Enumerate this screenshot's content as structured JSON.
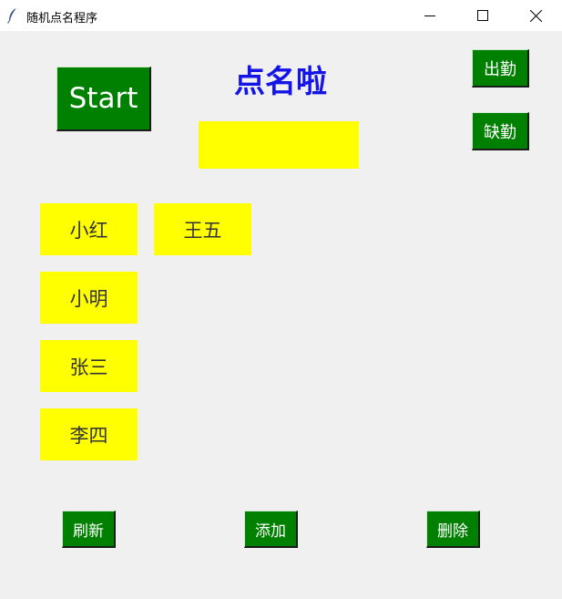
{
  "window": {
    "title": "随机点名程序",
    "controls": [
      "minimize-icon",
      "maximize-icon",
      "close-icon"
    ]
  },
  "main": {
    "heading": "点名啦",
    "start_label": "Start",
    "result": "",
    "present_label": "出勤",
    "absent_label": "缺勤"
  },
  "names": [
    "小红",
    "王五",
    "小明",
    "张三",
    "李四"
  ],
  "actions": {
    "refresh_label": "刷新",
    "add_label": "添加",
    "delete_label": "删除"
  },
  "colors": {
    "button_bg": "#008000",
    "button_text": "#ffffff",
    "name_bg": "#ffff00",
    "heading": "#1414e6",
    "background": "#f0f0f0"
  }
}
